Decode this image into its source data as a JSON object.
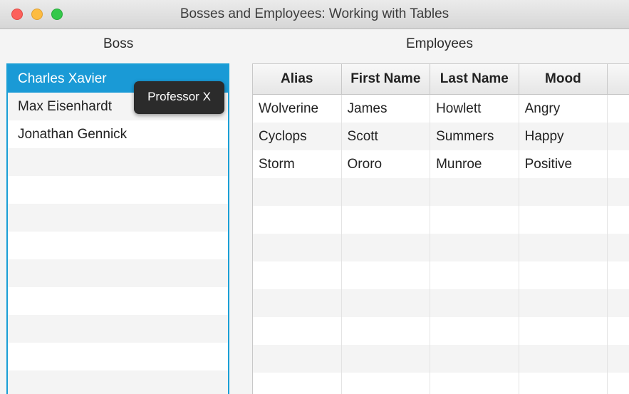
{
  "window": {
    "title": "Bosses and Employees: Working with Tables"
  },
  "boss_panel": {
    "label": "Boss",
    "items": [
      {
        "label": "Charles Xavier",
        "selected": true
      },
      {
        "label": "Max Eisenhardt",
        "selected": false
      },
      {
        "label": "Jonathan Gennick",
        "selected": false
      }
    ],
    "empty_rows": 9,
    "tooltip": "Professor X"
  },
  "employees_panel": {
    "label": "Employees",
    "columns": [
      "Alias",
      "First Name",
      "Last Name",
      "Mood",
      ""
    ],
    "rows": [
      [
        "Wolverine",
        "James",
        "Howlett",
        "Angry",
        ""
      ],
      [
        "Cyclops",
        "Scott",
        "Summers",
        "Happy",
        ""
      ],
      [
        "Storm",
        "Ororo",
        "Munroe",
        "Positive",
        ""
      ]
    ],
    "empty_rows": 8
  },
  "colors": {
    "selection": "#1a9ad6",
    "focus_border": "#1a9fd6",
    "tooltip_bg": "#2b2b2b"
  }
}
